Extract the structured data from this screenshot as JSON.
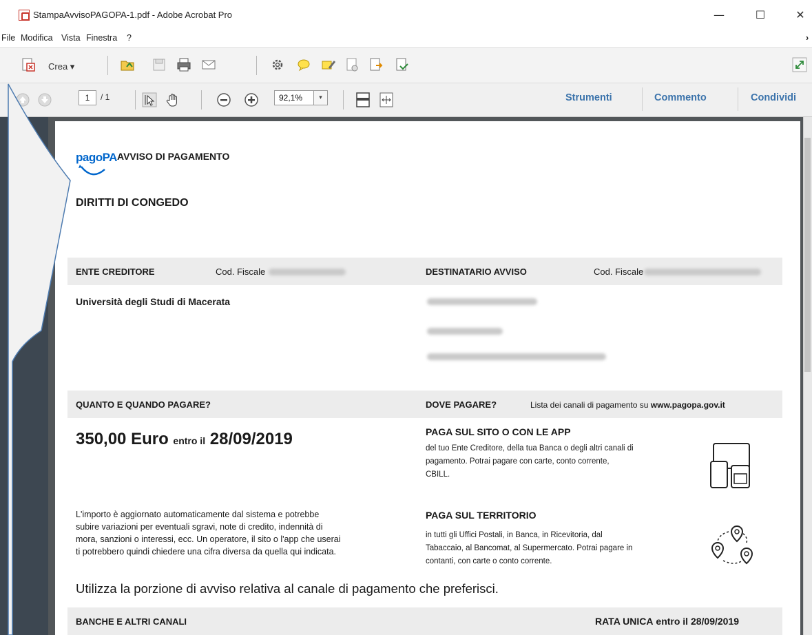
{
  "window": {
    "title": "StampaAvvisoPAGOPA-1.pdf - Adobe Acrobat Pro",
    "minimize": "—",
    "maximize": "☐",
    "close": "✕"
  },
  "menu": {
    "items": [
      "File",
      "Modifica",
      "Vista",
      "Finestra",
      "?"
    ],
    "overflow": "›"
  },
  "toolbar": {
    "crea_label": "Crea ▾"
  },
  "navigation": {
    "page_current": "1",
    "page_total": "/ 1",
    "zoom": "92,1%",
    "zoom_dropdown": "▾"
  },
  "right_tabs": [
    "Strumenti",
    "Commento",
    "Condividi"
  ],
  "document": {
    "logo": "pagoPA",
    "header": "AVVISO DI PAGAMENTO",
    "subject": "DIRITTI DI CONGEDO",
    "ente_label": "ENTE CREDITORE",
    "cod_fiscale_label": "Cod. Fiscale",
    "destinatario_label": "DESTINATARIO AVVISO",
    "cod_fiscale_label_2": "Cod. Fiscale",
    "ente_name": "Università degli Studi di Macerata",
    "quanto_label": "QUANTO E QUANDO PAGARE?",
    "dove_label": "DOVE PAGARE?",
    "dove_sub_prefix": "Lista dei canali di pagamento su",
    "dove_sub_link": "www.pagopa.gov.it",
    "amount": "350,00 Euro",
    "entro": "entro il",
    "due_date": "28/09/2019",
    "paga_sito_title": "PAGA SUL SITO O CON LE APP",
    "paga_sito_line1": "del tuo Ente Creditore, della tua Banca o degli altri canali di",
    "paga_sito_line2": "pagamento. Potrai pagare con carte, conto corrente,",
    "paga_sito_line3": "CBILL.",
    "importo_line1": "L'importo è aggiornato automaticamente dal sistema e potrebbe",
    "importo_line2": "subire variazioni per eventuali sgravi, note di credito, indennità di",
    "importo_line3": "mora, sanzioni o interessi, ecc. Un operatore, il sito o l'app che userai",
    "importo_line4": "ti potrebbero quindi chiedere una cifra diversa da quella qui indicata.",
    "paga_territorio_title": "PAGA SUL TERRITORIO",
    "paga_territorio_line1": "in tutti gli Uffici Postali, in Banca, in Ricevitoria, dal",
    "paga_territorio_line2": "Tabaccaio, al Bancomat, al Supermercato. Potrai pagare in",
    "paga_territorio_line3": "contanti, con carte o conto corrente.",
    "utilizza": "Utilizza la porzione di avviso relativa al canale di pagamento che preferisci.",
    "banche_label": "BANCHE E ALTRI CANALI",
    "rata_unica": "RATA UNICA",
    "rata_entro": "entro il 28/09/2019"
  },
  "colors": {
    "accent_blue": "#3b73ab",
    "pagopa_blue": "#0066cc",
    "band_gray": "#ececec"
  }
}
